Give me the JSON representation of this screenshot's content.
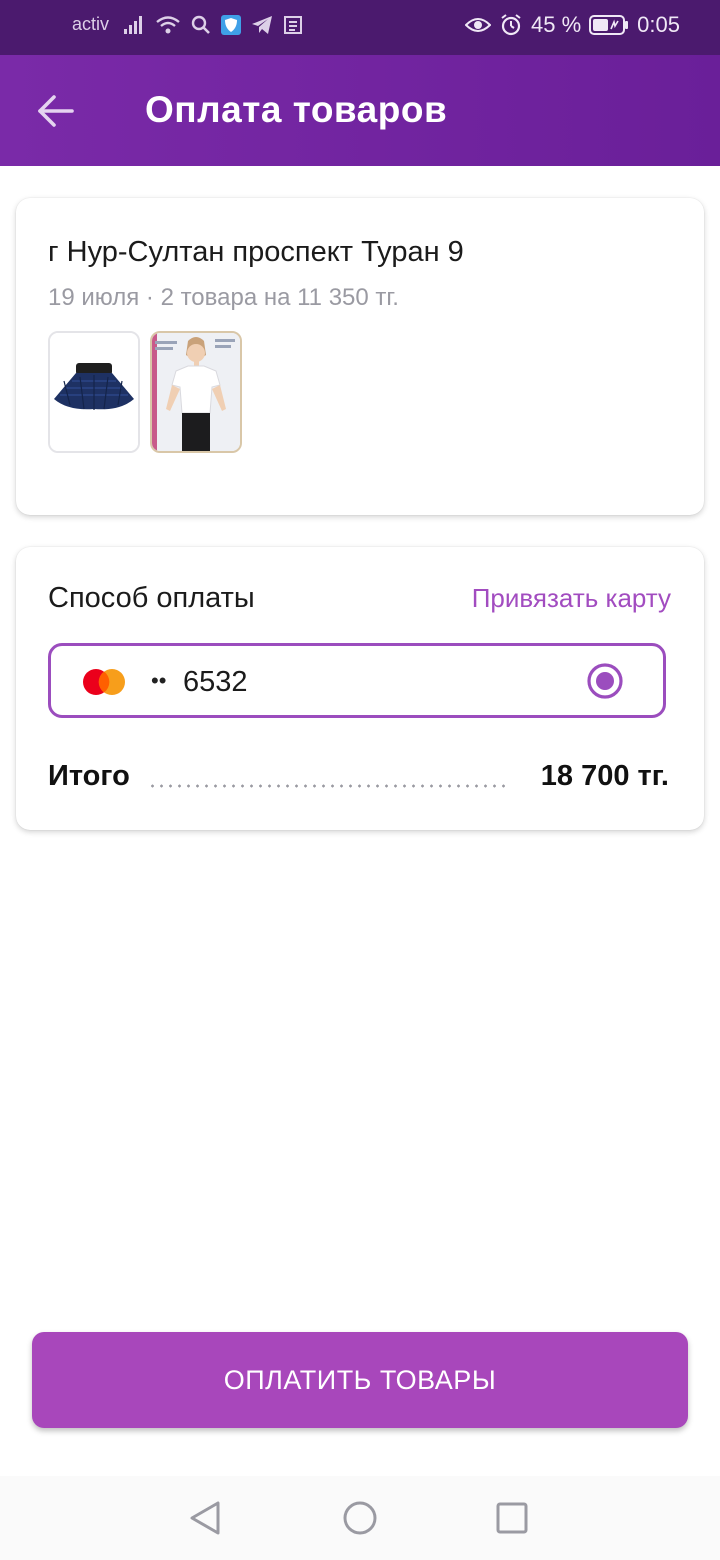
{
  "status_bar": {
    "carrier": "activ",
    "battery_percent": "45 %",
    "time": "0:05",
    "icons": [
      "signal-icon",
      "wifi-icon",
      "search-icon",
      "vpn-shield-icon",
      "telegram-icon",
      "news-icon",
      "eye-icon",
      "alarm-icon",
      "battery-icon"
    ]
  },
  "header": {
    "title": "Оплата товаров",
    "back_icon": "arrow-left-icon"
  },
  "order": {
    "address": "г Нур-Султан проспект Туран 9",
    "meta": "19 июля · 2 товара на 11 350 тг.",
    "items": [
      {
        "name": "skirt-thumbnail"
      },
      {
        "name": "tshirt-thumbnail"
      }
    ]
  },
  "payment": {
    "title": "Способ оплаты",
    "link_card_label": "Привязать карту",
    "card": {
      "brand": "mastercard",
      "dots": "••",
      "last4": "6532",
      "selected": true
    },
    "total_label": "Итого",
    "total_value": "18 700 тг."
  },
  "pay_button_label": "ОПЛАТИТЬ ТОВАРЫ",
  "colors": {
    "status_bar": "#4b1a6e",
    "app_bar": "#6a1f99",
    "accent": "#a847bb",
    "link": "#a24cc0"
  },
  "nav": {
    "back": "nav-back-icon",
    "home": "nav-home-icon",
    "recents": "nav-recents-icon"
  }
}
